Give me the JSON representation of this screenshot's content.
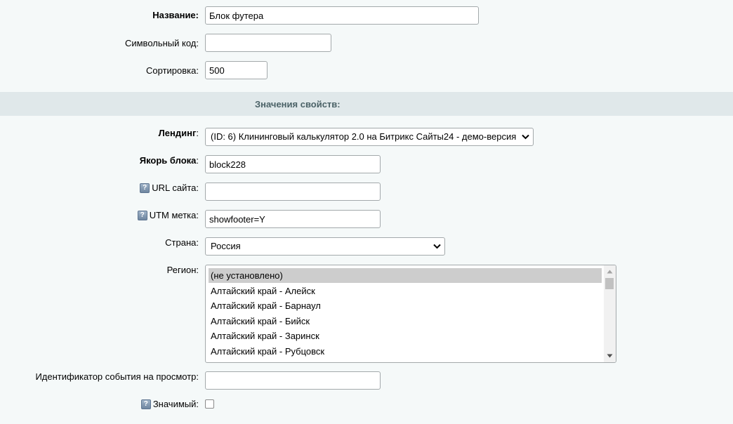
{
  "form": {
    "name": {
      "label": "Название:",
      "value": "Блок футера"
    },
    "symbol_code": {
      "label": "Символьный код:",
      "value": ""
    },
    "sort": {
      "label": "Сортировка:",
      "value": "500"
    }
  },
  "properties": {
    "section_title": "Значения свойств:",
    "landing": {
      "label": "Лендинг",
      "label_colon": ":",
      "selected": "(ID: 6) Клининговый калькулятор 2.0 на Битрикс Сайты24 - демо-версия"
    },
    "anchor": {
      "label": "Якорь блока",
      "label_colon": ":",
      "value": "block228"
    },
    "site_url": {
      "help_icon": "?",
      "label": "URL сайта:",
      "value": ""
    },
    "utm": {
      "help_icon": "?",
      "label": "UTM метка:",
      "value": "showfooter=Y"
    },
    "country": {
      "label": "Страна:",
      "selected": "Россия"
    },
    "region": {
      "label": "Регион:",
      "options": [
        "(не установлено)",
        "Алтайский край - Алейск",
        "Алтайский край - Барнаул",
        "Алтайский край - Бийск",
        "Алтайский край - Заринск",
        "Алтайский край - Рубцовск"
      ],
      "selected_index": 0
    },
    "view_event_id": {
      "label": "Идентификатор события на просмотр:",
      "value": ""
    },
    "important": {
      "help_icon": "?",
      "label": "Значимый:",
      "checked": false
    }
  },
  "colors": {
    "page_bg": "#f5f9f9",
    "section_bg": "#e0e8ea",
    "section_text": "#4b6267",
    "selected_option_bg": "#cdcdcd"
  }
}
